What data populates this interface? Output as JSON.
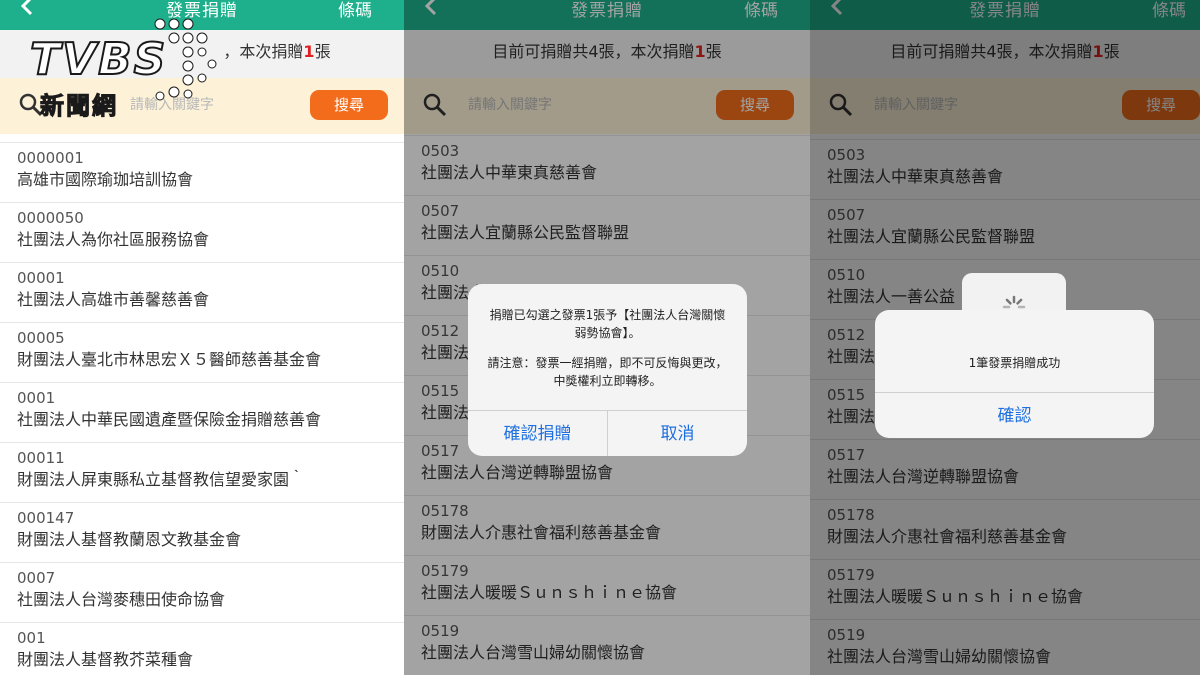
{
  "colors": {
    "header_green": "#1eb08c",
    "search_button_orange": "#f26c1c",
    "search_bar_cream": "#fdf2d8",
    "highlight_red": "#e02020",
    "ios_link_blue": "#1e6fe0"
  },
  "watermark": {
    "brand": "TVBS",
    "sub": "新聞網"
  },
  "header": {
    "back_icon": "chevron-left-icon",
    "title": "發票捐贈",
    "barcode_label": "條碼"
  },
  "donation_count": {
    "prefix": "目前可捐贈共4張，本次捐贈",
    "number": "1",
    "suffix": "張",
    "visible_in_panel1": "，本次捐贈"
  },
  "search": {
    "icon": "search-icon",
    "placeholder": "請輸入關鍵字",
    "button_label": "搜尋"
  },
  "panel1_list": [
    {
      "code": "0000001",
      "name": "高雄市國際瑜珈培訓協會"
    },
    {
      "code": "0000050",
      "name": "社團法人為你社區服務協會"
    },
    {
      "code": "00001",
      "name": "社團法人高雄市善馨慈善會"
    },
    {
      "code": "00005",
      "name": "財團法人臺北市林思宏Ｘ５醫師慈善基金會"
    },
    {
      "code": "0001",
      "name": "社團法人中華民國遺產暨保險金捐贈慈善會"
    },
    {
      "code": "00011",
      "name": "財團法人屏東縣私立基督教信望愛家園｀"
    },
    {
      "code": "000147",
      "name": "財團法人基督教蘭恩文教基金會"
    },
    {
      "code": "0007",
      "name": "社團法人台灣麥穗田使命協會"
    },
    {
      "code": "001",
      "name": "財團法人基督教芥菜種會"
    }
  ],
  "panel2_list": [
    {
      "code": "0503",
      "name": "社團法人中華東真慈善會"
    },
    {
      "code": "0507",
      "name": "社團法人宜蘭縣公民監督聯盟"
    },
    {
      "code": "0510",
      "name": "社團法人一善公益"
    },
    {
      "code": "0512",
      "name": "社團法人"
    },
    {
      "code": "0515",
      "name": "社團法人"
    },
    {
      "code": "0517",
      "name": "社團法人台灣逆轉聯盟協會"
    },
    {
      "code": "05178",
      "name": "財團法人介惠社會福利慈善基金會"
    },
    {
      "code": "05179",
      "name": "社團法人暖暖Ｓｕｎｓｈｉｎｅ協會"
    },
    {
      "code": "0519",
      "name": "社團法人台灣雪山婦幼關懷協會"
    }
  ],
  "confirm_dialog": {
    "line1": "捐贈已勾選之發票1張予【社團法人台灣關懷弱勢協會】。",
    "line2": "請注意：發票一經捐贈，即不可反悔與更改，中獎權利立即轉移。",
    "confirm_label": "確認捐贈",
    "cancel_label": "取消"
  },
  "success_dialog": {
    "message": "1筆發票捐贈成功",
    "ok_label": "確認",
    "loader_icon": "spinner-icon"
  }
}
